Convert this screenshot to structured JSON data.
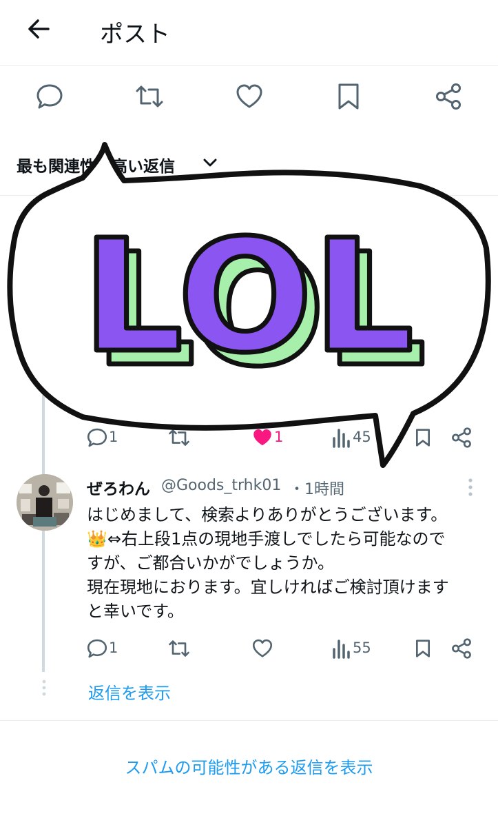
{
  "header": {
    "title": "ポスト",
    "back_icon": "arrow-left-icon"
  },
  "actions": [
    "comment-icon",
    "repost-icon",
    "like-icon",
    "bookmark-icon",
    "share-icon"
  ],
  "sort": {
    "label": "最も関連性の高い返信",
    "icon": "chevron-down-icon"
  },
  "sticker": {
    "text": "LOL",
    "fill": "#8b55f2",
    "shadow": "#a7f0ab",
    "outline": "#111111"
  },
  "prev_reply": {
    "comments": "1",
    "likes": "1",
    "views": "45",
    "like_color": "#f91880"
  },
  "reply": {
    "name": "ぜろわん",
    "handle": "@Goods_trhk01",
    "time": "・1時間",
    "lines": [
      "はじめまして、検索よりありがとうございます。",
      "👑⇔右上段1点の現地手渡しでしたら可能なので",
      "すが、ご都合いかがでしょうか。",
      "現在現地におります。宜しければご検討頂けます",
      "と幸いです。"
    ],
    "comments": "1",
    "views": "55"
  },
  "show_replies": "返信を表示",
  "show_spam": "スパムの可能性がある返信を表示",
  "colors": {
    "accent": "#1d9bf0",
    "secondary": "#536471"
  }
}
